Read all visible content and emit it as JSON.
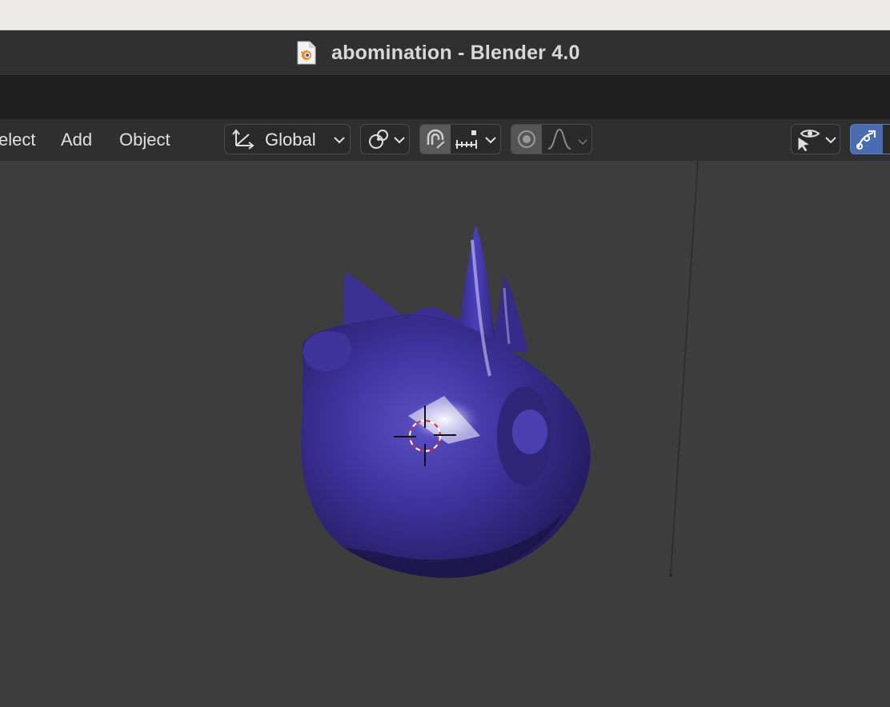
{
  "window": {
    "title": "abomination - Blender 4.0",
    "doc_icon": "blend-file-icon"
  },
  "header": {
    "menus": [
      "elect",
      "Add",
      "Object"
    ],
    "transform_orientation": "Global",
    "icons": {
      "transform": "transform-orientation-icon",
      "pivot": "pivot-point-icon",
      "snap": "snap-magnet-icon",
      "snap_increment": "snap-increment-icon",
      "proportional": "proportional-edit-icon",
      "falloff": "falloff-curve-icon",
      "visibility": "selectability-visibility-icon",
      "gizmo": "gizmo-toggle-icon"
    }
  },
  "colors": {
    "viewport_bg": "#3d3d3d",
    "header_bg": "#2f2f2f",
    "mesh_main": "#3a2e8a",
    "active_toggle": "#4a6cb0"
  }
}
